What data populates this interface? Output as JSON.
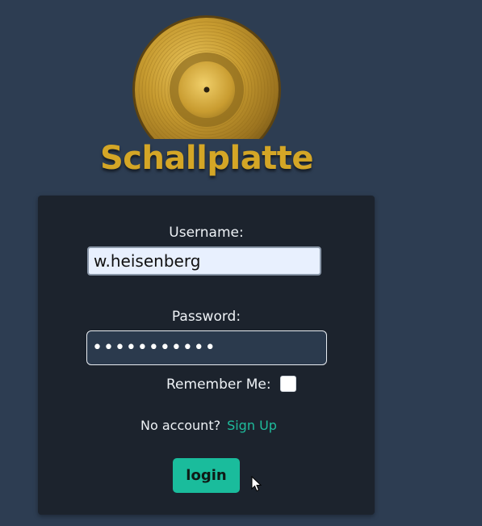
{
  "brand": {
    "title": "Schallplatte",
    "logo_icon": "vinyl-record-icon",
    "title_color": "#d4a626"
  },
  "login_form": {
    "username_label": "Username:",
    "username_value": "w.heisenberg",
    "password_label": "Password:",
    "password_masked": "•••••••••••",
    "remember_label": "Remember Me:",
    "remember_checked": false,
    "no_account_text": "No account?",
    "signup_link": "Sign Up",
    "login_button": "login"
  },
  "colors": {
    "background": "#2d3d52",
    "card": "#1c232d",
    "accent": "#1abc9c",
    "link": "#1fbc9c"
  }
}
